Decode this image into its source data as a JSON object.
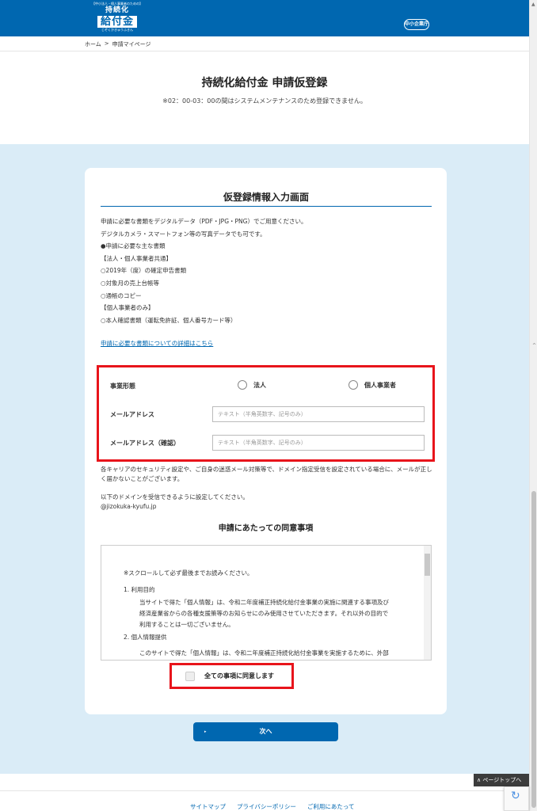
{
  "header": {
    "logo_small": "【中小法人・個人事業者のための】",
    "logo_top": "持続化",
    "logo_main": "給付金",
    "logo_sub": "じぞくかきゅうふきん",
    "agency_logo": "中小企業庁"
  },
  "breadcrumb": {
    "home": "ホーム",
    "sep": ">",
    "current": "申請マイページ"
  },
  "page": {
    "title": "持続化給付金 申請仮登録",
    "maintenance": "※02：00-03：00の間はシステムメンテナンスのため登録できません。"
  },
  "card": {
    "title": "仮登録情報入力画面",
    "doc_lines": [
      "申請に必要な書類をデジタルデータ（PDF・JPG・PNG）でご用意ください。",
      "デジタルカメラ・スマートフォン等の写真データでも可です。",
      "●申請に必要な主な書類",
      "【法人・個人事業者共通】",
      "○2019年（度）の確定申告書類",
      "○対象月の売上台帳等",
      "○通帳のコピー",
      "【個人事業者のみ】",
      "○本人確認書類（運転免許証、個人番号カード等）"
    ],
    "doc_link": "申請に必要な書類についての詳細はこちら"
  },
  "form": {
    "business_type_label": "事業形態",
    "option_corp": "法人",
    "option_individual": "個人事業者",
    "email_label": "メールアドレス",
    "email_placeholder": "テキスト（半角英数字、記号のみ）",
    "email_confirm_label": "メールアドレス（確認）",
    "email_confirm_placeholder": "テキスト（半角英数字、記号のみ）"
  },
  "notice": {
    "carrier": "各キャリアのセキュリティ設定や、ご自身の迷惑メール対策等で、ドメイン指定受信を設定されている場合に、メールが正しく届かないことがございます。",
    "domain_intro": "以下のドメインを受信できるように設定してください。",
    "domain": "@jizokuka-kyufu.jp"
  },
  "consent": {
    "title": "申請にあたっての同意事項",
    "lines": [
      "※スクロールして必ず最後までお読みください。",
      "1. 利用目的",
      "当サイトで得た「個人情報」は、令和二年度補正持続化給付金事業の実施に関連する事項及び",
      "経済産業省からの各種支援策等のお知らせにのみ使用させていただきます。それ以外の目的で",
      "利用することは一切ございません。",
      "2. 個人情報提供",
      "このサイトで得た「個人情報」は、令和二年度補正持続化給付金事業を実施するために、外部"
    ],
    "agree_label": "全ての事項に同意します"
  },
  "actions": {
    "next": "次へ",
    "next_arrow": "▸"
  },
  "footer": {
    "links": [
      "サイトマップ",
      "プライバシーポリシー",
      "ご利用にあたって"
    ]
  },
  "pagetop": "∧ ページトップへ",
  "colors": {
    "brand_blue": "#0067b0",
    "highlight_red": "#e8141b",
    "section_bg": "#daecf7"
  }
}
